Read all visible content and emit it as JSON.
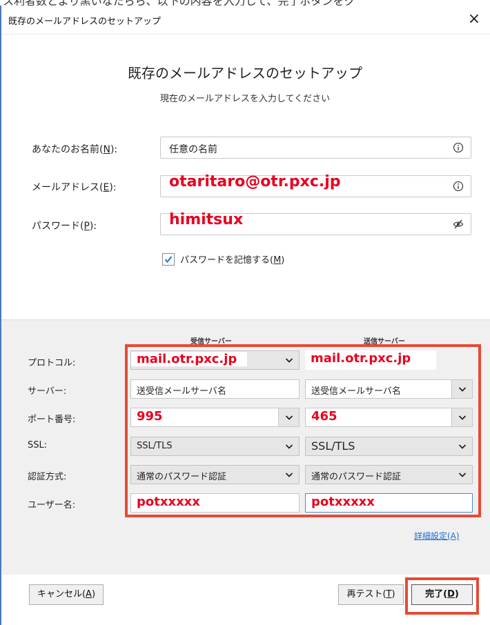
{
  "top_strip_text": "ス利者数とより黒いなたらら、以下の内容を入力して、完了ボタンをク",
  "window": {
    "title": "既存のメールアドレスのセットアップ",
    "close_glyph": "×"
  },
  "heading": "既存のメールアドレスのセットアップ",
  "subheading": "現在のメールアドレスを入力してください",
  "fields": {
    "name": {
      "label": "あなたのお名前(",
      "accesskey": "N",
      "label_end": "):",
      "value": "任意の名前",
      "icon": "info-icon"
    },
    "email": {
      "label": "メールアドレス(",
      "accesskey": "E",
      "label_end": "):",
      "value": "otaritaro@otr.pxc.jp",
      "icon": "info-icon"
    },
    "password": {
      "label": "パスワード(",
      "accesskey": "P",
      "label_end": "):",
      "value": "himitsux",
      "icon": "eye-slash-icon"
    }
  },
  "remember": {
    "label": "パスワードを記憶する(",
    "accesskey": "M",
    "label_end": ")",
    "checked": true
  },
  "server": {
    "incoming_header": "受信サーバー",
    "outgoing_header": "送信サーバー",
    "rows": {
      "protocol": {
        "label": "プロトコル:",
        "incoming": "mail.otr.pxc.jp",
        "outgoing": "mail.otr.pxc.jp"
      },
      "server": {
        "label": "サーバー:",
        "incoming": "送受信メールサーバ名",
        "outgoing": "送受信メールサーバ名"
      },
      "port": {
        "label": "ポート番号:",
        "incoming": "995",
        "outgoing": "465"
      },
      "ssl": {
        "label": "SSL:",
        "incoming": "SSL/TLS",
        "outgoing": "SSL/TLS"
      },
      "auth": {
        "label": "認証方式:",
        "incoming": "通常のパスワード認証",
        "outgoing": "通常のパスワード認証"
      },
      "username": {
        "label": "ユーザー名:",
        "incoming": "potxxxxx",
        "outgoing": "potxxxxx"
      }
    }
  },
  "advanced_link": "詳細設定(A)",
  "buttons": {
    "cancel": {
      "label": "キャンセル(",
      "accesskey": "A",
      "label_end": ")"
    },
    "retest": {
      "label": "再テスト(",
      "accesskey": "T",
      "label_end": ")"
    },
    "done": {
      "label": "完了(",
      "accesskey": "D",
      "label_end": ")"
    }
  },
  "colors": {
    "annotation_red": "#e64a35",
    "value_red": "#e8001e",
    "link_blue": "#1a6fd0"
  }
}
